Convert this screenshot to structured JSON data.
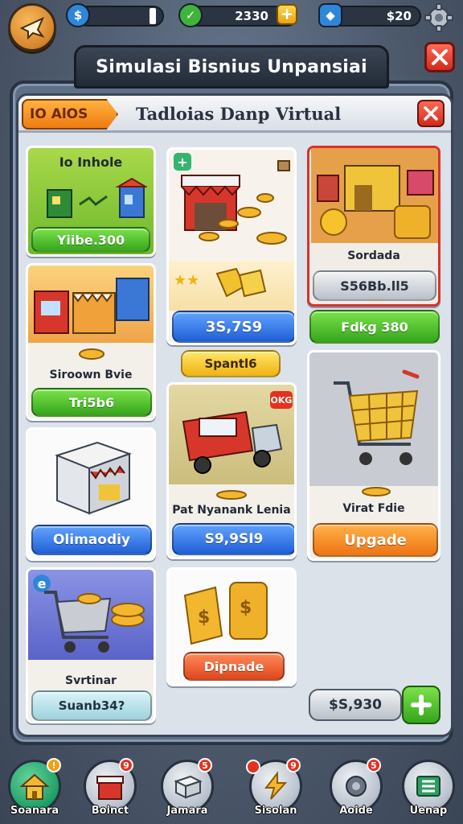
{
  "topbar": {
    "coins_value": "",
    "cash_value": "2330",
    "gems_value": "$20"
  },
  "panel_title": "Simulasi Bisnius Unpansiai",
  "inner": {
    "badge": "IO AlOS",
    "title": "Tadloias Danp Virtual"
  },
  "cards": {
    "c1": {
      "label": "Io Inhole",
      "button": "Yiibe.300"
    },
    "c2": {
      "button": "3S,7S9",
      "tag": "Spantl6"
    },
    "c3": {
      "label": "Sordada",
      "price": "S56Bb.ll5",
      "button": "Fdkg 380"
    },
    "c4": {
      "label": "Siroown Bvie",
      "button": "Tri5b6"
    },
    "c5": {
      "label": "Pat Nyanank Lenia",
      "button": "S9,9SI9",
      "tag": "OKG"
    },
    "c6": {
      "label": "Virat Fdie",
      "button": "Upgade"
    },
    "c7": {
      "button": "Olimaodiy"
    },
    "c8": {
      "label": "Svrtinar",
      "button": "Suanb34?"
    },
    "c9": {
      "button": "Dipnade"
    }
  },
  "bottom": {
    "price": "$S,930"
  },
  "nav": [
    {
      "label": "Soanara",
      "badge": "!"
    },
    {
      "label": "Boinct",
      "badge": "9"
    },
    {
      "label": "Jamara",
      "badge": "5"
    },
    {
      "label": "Sisolan",
      "badge": "9"
    },
    {
      "label": "Aoide",
      "badge": "5"
    },
    {
      "label": "Uenap",
      "badge": ""
    }
  ],
  "colors": {
    "accent_green": "#35a51c",
    "accent_blue": "#1f5fd6",
    "accent_orange": "#ee7412",
    "close_red": "#d22a1e"
  }
}
